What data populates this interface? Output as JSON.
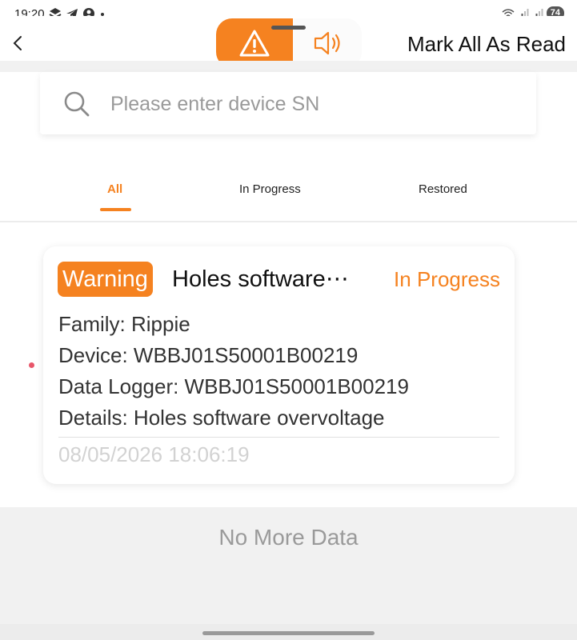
{
  "status_bar": {
    "time": "19:20",
    "battery": "74",
    "icons": [
      "stacked-app-icon",
      "telegram-icon",
      "account-icon",
      "dot-icon",
      "wifi-icon",
      "signal-icon",
      "signal-icon"
    ]
  },
  "header": {
    "mark_all_label": "Mark All As Read",
    "toggle": {
      "active": "alarm-warning",
      "inactive": "speaker-notifications"
    }
  },
  "search": {
    "placeholder": "Please enter device SN",
    "value": ""
  },
  "tabs": [
    {
      "label": "All",
      "active": true
    },
    {
      "label": "In Progress",
      "active": false
    },
    {
      "label": "Restored",
      "active": false
    }
  ],
  "alarms": [
    {
      "badge": "Warning",
      "title": "Holes software⋯",
      "status": "In Progress",
      "family": "Family: Rippie",
      "device": "Device: WBBJ01S50001B00219",
      "logger": "Data Logger: WBBJ01S50001B00219",
      "details": "Details: Holes software overvoltage",
      "time": "08/05/2026 18:06:19",
      "unread": true
    }
  ],
  "footer": {
    "no_more": "No More Data"
  },
  "colors": {
    "accent": "#f58220",
    "unread_dot": "#e8566a",
    "muted": "#9a9a9a"
  }
}
